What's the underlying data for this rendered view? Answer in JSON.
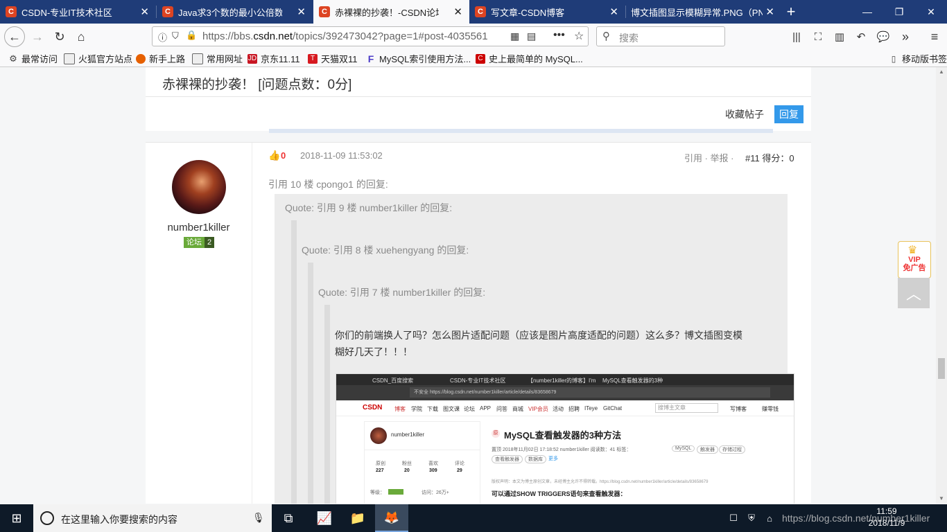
{
  "browser": {
    "tabs": [
      {
        "label": "CSDN-专业IT技术社区",
        "icon": "csdn-icon"
      },
      {
        "label": "Java求3个数的最小公倍数(3个",
        "icon": "csdn-icon"
      },
      {
        "label": "赤裸裸的抄袭！-CSDN论坛",
        "icon": "csdn-icon",
        "active": true
      },
      {
        "label": "写文章-CSDN博客",
        "icon": "csdn-icon"
      },
      {
        "label": "博文插图显示模糊异常.PNG（PNG",
        "icon": "none"
      }
    ],
    "new_tab": "+",
    "url_host_prefix": "https://bbs.",
    "url_host": "csdn.net",
    "url_path": "/topics/392473042?page=1#post-4035561",
    "search_placeholder": "搜索",
    "bookmarks": [
      "最常访问",
      "火狐官方站点",
      "新手上路",
      "常用网址",
      "京东11.11",
      "天猫双11",
      "MySQL索引使用方法...",
      "史上最简单的 MySQL..."
    ],
    "mobile_bookmarks": "移动版书签"
  },
  "topic": {
    "title": "赤裸裸的抄袭！ [问题点数：0分]",
    "favorite_label": "收藏帖子",
    "reply_label": "回复"
  },
  "post": {
    "likes": "0",
    "time": "2018-11-09 11:53:02",
    "actions": "引用 · 举报 ·",
    "floor": "#11 得分：0",
    "author": "number1killer",
    "badge_label": "论坛",
    "badge_level": "2",
    "quote_intro": "引用 10 楼 cpongo1 的回复:",
    "quotes": [
      "Quote: 引用 9 楼 number1killer 的回复:",
      "Quote: 引用 8 楼 xuehengyang 的回复:",
      "Quote: 引用 7 楼 number1killer 的回复:"
    ],
    "body": "你们的前端换人了吗？怎么图片适配问题（应该是图片高度适配的问题）这么多？博文插图变模糊好几天了！！！"
  },
  "embedded_screenshot": {
    "tabs": [
      "CSDN_百度搜索",
      "CSDN-专业IT技术社区",
      "【number1killer的博客】I'm",
      "MySQL查看触发器的3种"
    ],
    "url": "不安全  https://blog.csdn.net/number1killer/article/details/83658679",
    "nav": [
      "博客",
      "学院",
      "下载",
      "图文课",
      "论坛",
      "APP",
      "问答",
      "商城",
      "VIP会员",
      "活动",
      "招聘",
      "ITeye",
      "GitChat"
    ],
    "search_placeholder": "搜博主文章",
    "write": "写博客",
    "earn": "赚零钱",
    "username": "number1killer",
    "stats_labels": [
      "原创",
      "粉丝",
      "喜欢",
      "评论"
    ],
    "stats_values": [
      "227",
      "20",
      "309",
      "29"
    ],
    "level_label": "等级：",
    "visits": "访问：26万+",
    "article_badge": "原",
    "article_title": "MySQL查看触发器的3种方法",
    "article_meta": "置顶  2018年11月02日 17:18:52    number1killer   阅读数：41   标签：",
    "tags": [
      "MySQL",
      "触发器",
      "存储过程"
    ],
    "tags2": [
      "查看触发器",
      "数据库",
      "更多"
    ],
    "copyright": "版权声明：本文为博主原创文章，未经博主允许不得转载。https://blog.csdn.net/number1killer/article/details/83658679",
    "lead": "可以通过SHOW TRIGGERS语句来查看触发器："
  },
  "float": {
    "vip_line1": "VIP",
    "vip_line2": "免广告"
  },
  "taskbar": {
    "search_text": "在这里输入你要搜索的内容",
    "time": "11:59",
    "date": "2018/11/9",
    "watermark": "https://blog.csdn.net/number1killer"
  }
}
